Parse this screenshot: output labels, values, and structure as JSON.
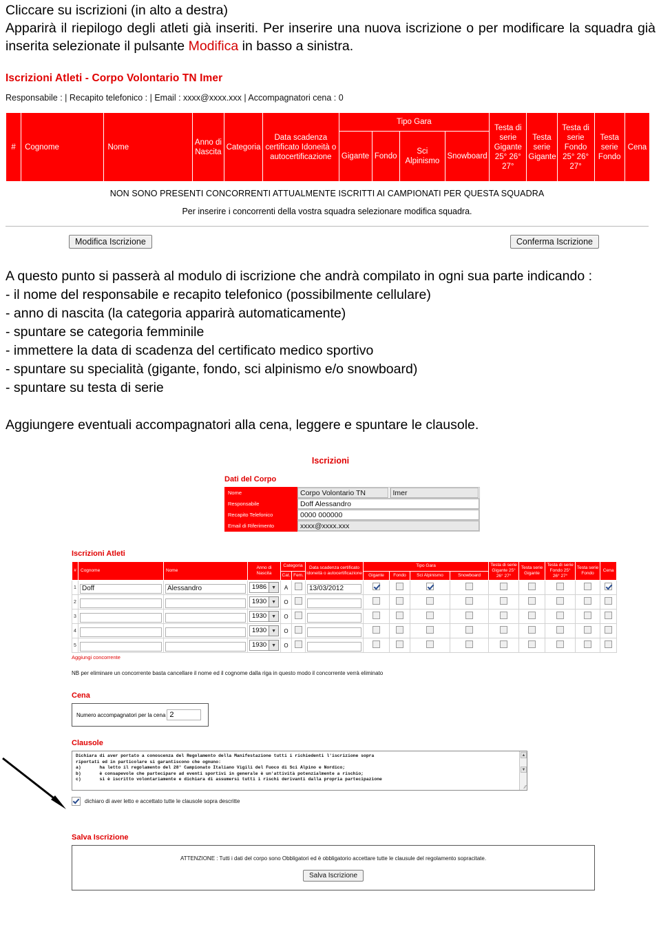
{
  "intro": {
    "line1": "Cliccare su iscrizioni (in alto a destra)",
    "line2": "Apparirà il riepilogo degli atleti già inseriti. Per inserire una nuova iscrizione o per modificare la squadra già inserita selezionate il pulsante ",
    "line2_highlight": "Modifica",
    "line2_end": " in basso a sinistra."
  },
  "screenshot1": {
    "title": "Iscrizioni Atleti - Corpo Volontario TN Imer",
    "meta": "Responsabile :  |  Recapito telefonico :  |  Email : xxxx@xxxx.xxx  |  Accompagnatori cena : 0",
    "headers": {
      "num": "#",
      "cognome": "Cognome",
      "nome": "Nome",
      "anno": "Anno di Nascita",
      "categoria": "Categoria",
      "data_scadenza": "Data scadenza certificato Idoneità o autocertificazione",
      "tipo_gara": "Tipo Gara",
      "gigante": "Gigante",
      "fondo": "Fondo",
      "sci_alpinismo": "Sci Alpinismo",
      "snowboard": "Snowboard",
      "testa_gigante_anni": "Testa di serie Gigante 25° 26° 27°",
      "testa_gigante": "Testa serie Gigante",
      "testa_fondo_anni": "Testa di serie Fondo 25° 26° 27°",
      "testa_fondo": "Testa serie Fondo",
      "cena": "Cena"
    },
    "empty_msg_1": "NON SONO PRESENTI CONCORRENTI ATTUALMENTE ISCRITTI AI CAMPIONATI PER QUESTA SQUADRA",
    "empty_msg_2": "Per inserire i concorrenti della vostra squadra selezionare modifica squadra.",
    "btn_modifica": "Modifica Iscrizione",
    "btn_conferma": "Conferma Iscrizione"
  },
  "body": {
    "p1": "A questo punto si passerà al modulo di iscrizione che andrà compilato in ogni sua parte indicando :",
    "b1": "- il nome del responsabile e recapito telefonico (possibilmente cellulare)",
    "b2": "- anno di nascita (la categoria apparirà automaticamente)",
    "b3": "- spuntare se categoria femminile",
    "b4": "- immettere la data di scadenza del certificato medico sportivo",
    "b5": "- spuntare su specialità (gigante, fondo, sci alpinismo e/o snowboard)",
    "b6": "- spuntare su testa di serie",
    "p2": "Aggiungere eventuali accompagnatori alla cena, leggere e spuntare le clausole."
  },
  "screenshot2": {
    "page_title": "Iscrizioni",
    "corpo": {
      "section_title": "Dati del Corpo",
      "rows": [
        {
          "label": "Nome",
          "value1": "Corpo Volontario TN",
          "value2": "Imer"
        },
        {
          "label": "Responsabile",
          "value1": "Doff Alessandro"
        },
        {
          "label": "Recapito Telefonico",
          "value1": "0000 000000"
        },
        {
          "label": "Email di Riferimento",
          "value1": "xxxx@xxxx.xxx"
        }
      ]
    },
    "atleti": {
      "section_title": "Iscrizioni Atleti",
      "headers": {
        "num": "#",
        "cognome": "Cognome",
        "nome": "Nome",
        "anno": "Anno di Nascita",
        "categoria": "Categoria",
        "cat": "Cat.",
        "fem": "Fem.",
        "data_scadenza": "Data scadenza certificato Idoneità o autocertificazione",
        "tipo_gara": "Tipo Gara",
        "gigante": "Gigante",
        "fondo": "Fondo",
        "sci_alpinismo": "Sci Alpinismo",
        "snowboard": "Snowboard",
        "testa_gigante_anni": "Testa di serie Gigante 25° 26° 27°",
        "testa_gigante": "Testa serie Gigante",
        "testa_fondo_anni": "Testa di serie Fondo 25° 26° 27°",
        "testa_fondo": "Testa serie Fondo",
        "cena": "Cena"
      },
      "rows": [
        {
          "num": "1",
          "cognome": "Doff",
          "nome": "Alessandro",
          "anno": "1986",
          "cat": "A",
          "fem": false,
          "data": "13/03/2012",
          "gigante": true,
          "fondo": false,
          "sci_alpinismo": true,
          "snowboard": false,
          "tsg_anni": false,
          "tsg": false,
          "tsf_anni": false,
          "tsf": false,
          "cena": true
        },
        {
          "num": "2",
          "cognome": "",
          "nome": "",
          "anno": "1930",
          "cat": "O",
          "fem": false,
          "data": "",
          "gigante": false,
          "fondo": false,
          "sci_alpinismo": false,
          "snowboard": false,
          "tsg_anni": false,
          "tsg": false,
          "tsf_anni": false,
          "tsf": false,
          "cena": false
        },
        {
          "num": "3",
          "cognome": "",
          "nome": "",
          "anno": "1930",
          "cat": "O",
          "fem": false,
          "data": "",
          "gigante": false,
          "fondo": false,
          "sci_alpinismo": false,
          "snowboard": false,
          "tsg_anni": false,
          "tsg": false,
          "tsf_anni": false,
          "tsf": false,
          "cena": false
        },
        {
          "num": "4",
          "cognome": "",
          "nome": "",
          "anno": "1930",
          "cat": "O",
          "fem": false,
          "data": "",
          "gigante": false,
          "fondo": false,
          "sci_alpinismo": false,
          "snowboard": false,
          "tsg_anni": false,
          "tsg": false,
          "tsf_anni": false,
          "tsf": false,
          "cena": false
        },
        {
          "num": "5",
          "cognome": "",
          "nome": "",
          "anno": "1930",
          "cat": "O",
          "fem": false,
          "data": "",
          "gigante": false,
          "fondo": false,
          "sci_alpinismo": false,
          "snowboard": false,
          "tsg_anni": false,
          "tsg": false,
          "tsf_anni": false,
          "tsf": false,
          "cena": false
        }
      ],
      "add_link": "Aggiungi concorrente",
      "nb": "NB per eliminare un concorrente basta cancellare il nome ed il cognome dalla riga in questo modo il concorrente verrà eliminato"
    },
    "cena": {
      "section_title": "Cena",
      "label": "Numero accompagnatori per la cena",
      "value": "2"
    },
    "clausole": {
      "section_title": "Clausole",
      "text": "Dichiara di aver portato a conoscenza del Regolamento della Manifestazione tutti i richiedenti l'iscrizione sopra\nriportati ed in particolare si garantiscono che ognuno:\na)       ha letto il regolamento del 28° Campionato Italiano Vigili del Fuoco di Sci Alpino e Nordico;\nb)       è consapevole che partecipare ad eventi sportivi in generale è un'attività potenzialmente a rischio;\nc)       si è iscritto volontariamente e dichiara di assumersi tutti i rischi derivanti dalla propria partecipazione",
      "accept_checked": true,
      "accept_label": "dichiaro di aver letto e accettato tutte le clausole sopra descritte"
    },
    "salva": {
      "section_title": "Salva Iscrizione",
      "warning": "ATTENZIONE : Tutti i dati del corpo sono Obbligatori ed è obbligatorio accettare tutte le clausule del regolamento sopracitate.",
      "button": "Salva Iscrizione"
    }
  },
  "colors": {
    "header_red": "#ff0000",
    "title_red": "#e00000",
    "highlight_red": "#d40000"
  }
}
